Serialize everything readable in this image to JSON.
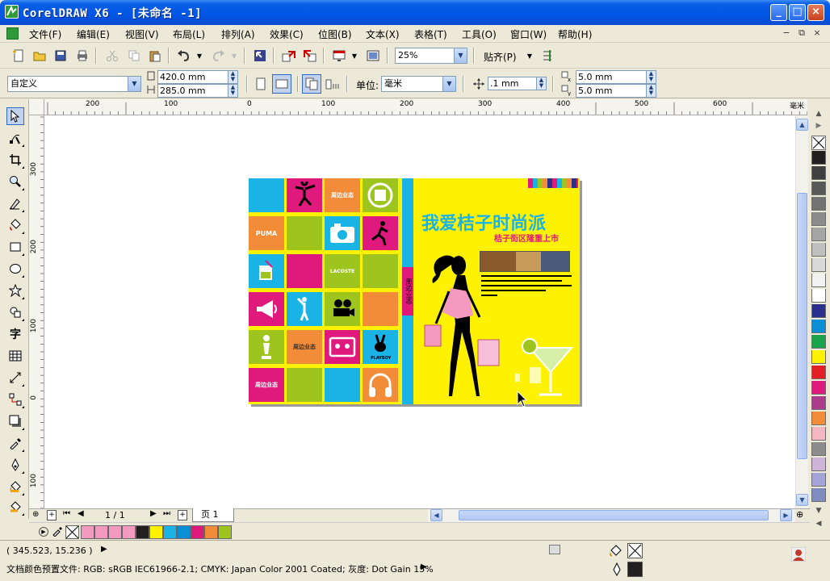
{
  "window": {
    "title": "CorelDRAW X6 - [未命名 -1]",
    "buttons": [
      "_",
      "□",
      "×"
    ]
  },
  "menubar": {
    "items": [
      "文件(F)",
      "编辑(E)",
      "视图(V)",
      "布局(L)",
      "排列(A)",
      "效果(C)",
      "位图(B)",
      "文本(X)",
      "表格(T)",
      "工具(O)",
      "窗口(W)",
      "帮助(H)"
    ],
    "mdi": [
      "−",
      "⧉",
      "×"
    ]
  },
  "toolbar_standard": {
    "zoom_value": "25%",
    "snap_label": "贴齐(P)"
  },
  "property_bar": {
    "page_size": "自定义",
    "width": "420.0 mm",
    "height": "285.0 mm",
    "unit_label": "单位:",
    "unit_value": "毫米",
    "nudge": ".1 mm",
    "dup_x": "5.0 mm",
    "dup_y": "5.0 mm"
  },
  "rulers": {
    "h_labels": [
      "200",
      "100",
      "0",
      "100",
      "200",
      "300",
      "400",
      "500",
      "600",
      "毫米"
    ],
    "v_labels": [
      "300",
      "200",
      "100",
      "0",
      "100"
    ]
  },
  "page_nav": {
    "page_count": "1 / 1",
    "page_tab": "页 1"
  },
  "status": {
    "coords": "( 345.523, 15.236 )",
    "color_profile": "文档颜色预置文件: RGB: sRGB IEC61966-2.1; CMYK: Japan Color 2001 Coated; 灰度: Dot Gain 15%"
  },
  "artwork": {
    "headline": "我爱桔子时尚派",
    "subhead": "桔子街区隆重上市",
    "cell_text": "周边业态",
    "vertical_text": "周边业态",
    "brands": [
      "PUMA",
      "LACOSTE",
      "PLAYBOY"
    ]
  },
  "colors": {
    "title_blue": "#0055e5",
    "artwork_yellow": "#fff200",
    "cyan": "#1ab3e6",
    "magenta": "#e0197d",
    "lime": "#9dc51d",
    "orange": "#f28c38"
  },
  "palette_colors": [
    "#231f20",
    "#404040",
    "#595959",
    "#737373",
    "#8c8c8c",
    "#a6a6a6",
    "#bfbfbf",
    "#d9d9d9",
    "#f2f2f2",
    "#ffffff",
    "#2a2f8a",
    "#0a8fd6",
    "#1aa34a",
    "#fff200",
    "#e31e24",
    "#e0197d",
    "#ab3c8c",
    "#f28c38",
    "#f4b6c2",
    "#8c8c8c",
    "#cdb4d8",
    "#a4a4d8",
    "#7f8cc0"
  ],
  "doc_colors": [
    "#f49ac1",
    "#f49ac1",
    "#f49ac1",
    "#f49ac1",
    "#231f20",
    "#fff200",
    "#1ab3e6",
    "#0a8fd6",
    "#e0197d",
    "#f28c38",
    "#9dc51d"
  ]
}
